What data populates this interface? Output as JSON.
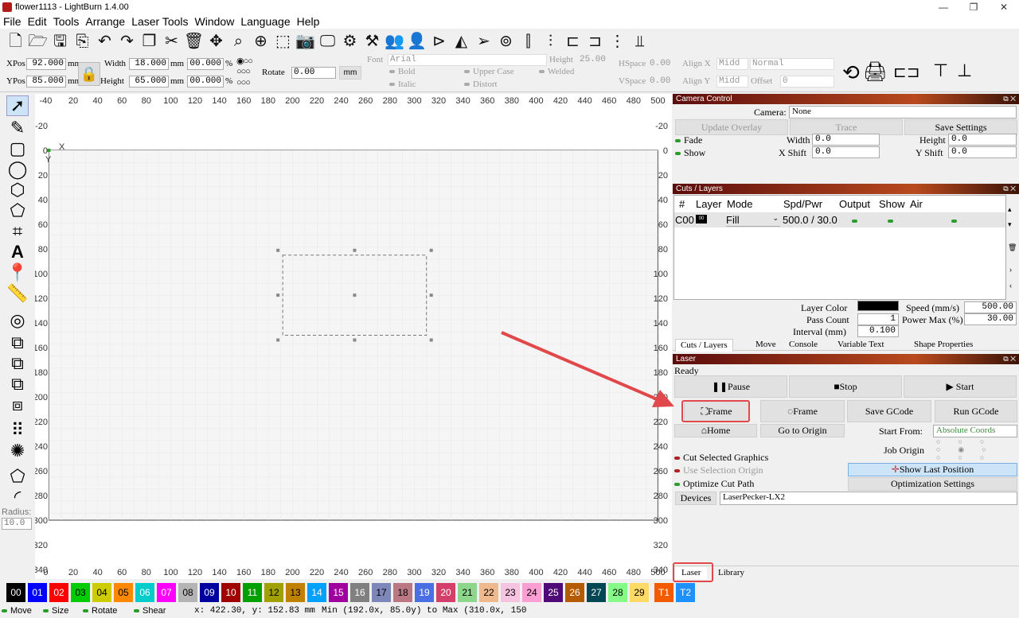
{
  "window": {
    "title": "flower1113 - LightBurn 1.4.00",
    "controls": [
      "—",
      "❐",
      "✕"
    ]
  },
  "menu": [
    "File",
    "Edit",
    "Tools",
    "Arrange",
    "Laser Tools",
    "Window",
    "Language",
    "Help"
  ],
  "toolbar_icons": [
    "new-file-icon",
    "open-folder-icon",
    "save-icon",
    "import-icon",
    "undo-icon",
    "redo-icon",
    "copy-icon",
    "cut-icon",
    "delete-icon",
    "move-icon",
    "zoom-fit-icon",
    "zoom-in-icon",
    "zoom-selection-icon",
    "camera-icon",
    "monitor-icon",
    "settings-icon",
    "tools-icon",
    "users-icon",
    "user-icon",
    "convert-icon",
    "mirror-icon",
    "send-icon",
    "target-icon",
    "align-icon",
    "distribute-icon"
  ],
  "props": {
    "xpos_label": "XPos",
    "xpos": "92.000",
    "ypos_label": "YPos",
    "ypos": "85.000",
    "mm": "mm",
    "width_label": "Width",
    "width": "18.000",
    "height_label": "Height",
    "height": "65.000",
    "pct1": "00.000",
    "pct2": "00.000",
    "pct_sign": "%",
    "rotate_label": "Rotate",
    "rotate": "0.00",
    "rotate_unit": "mm",
    "font_label": "Font",
    "font": "Arial",
    "fheight_label": "Height",
    "fheight": "25.00",
    "bold": "Bold",
    "italic": "Italic",
    "upper": "Upper Case",
    "distort": "Distort",
    "welded": "Welded",
    "hspace_label": "HSpace",
    "hspace": "0.00",
    "vspace_label": "VSpace",
    "vspace": "0.00",
    "alignx_label": "Align X",
    "alignx": "Midd",
    "aligny_label": "Align Y",
    "aligny": "Midd",
    "normal": "Normal",
    "offset_label": "Offset",
    "offset": "0"
  },
  "left_tools": {
    "radius_label": "Radius:",
    "radius": "10.0"
  },
  "rulers": {
    "top": [
      "-40",
      "20",
      "40",
      "60",
      "80",
      "100",
      "120",
      "140",
      "160",
      "180",
      "200",
      "220",
      "240",
      "260",
      "280",
      "300",
      "320",
      "340",
      "360",
      "380",
      "400",
      "420",
      "440",
      "460",
      "480",
      "500"
    ],
    "left": [
      "-20",
      "0",
      "20",
      "40",
      "60",
      "80",
      "100",
      "120",
      "140",
      "160",
      "180",
      "200",
      "220",
      "240",
      "260",
      "280",
      "300",
      "320",
      "340"
    ],
    "origin_x": "X",
    "origin_y": "Y"
  },
  "camera": {
    "header": "Camera Control",
    "camera_label": "Camera:",
    "camera": "None",
    "update_overlay": "Update Overlay",
    "trace": "Trace",
    "save_settings": "Save Settings",
    "fade": "Fade",
    "show": "Show",
    "width_label": "Width",
    "width": "0.0",
    "height_label": "Height",
    "height": "0.0",
    "xshift_label": "X Shift",
    "xshift": "0.0",
    "yshift_label": "Y Shift",
    "yshift": "0.0"
  },
  "layers": {
    "header": "Cuts / Layers",
    "cols": [
      "#",
      "Layer",
      "Mode",
      "Spd/Pwr",
      "Output",
      "Show",
      "Air"
    ],
    "row": {
      "id": "C00",
      "layer": "00",
      "mode": "Fill",
      "spdpwr": "500.0 / 30.0"
    },
    "layer_color_label": "Layer Color",
    "pass_count_label": "Pass Count",
    "pass_count": "1",
    "interval_label": "Interval (mm)",
    "interval": "0.100",
    "speed_label": "Speed (mm/s)",
    "speed": "500.00",
    "power_label": "Power Max (%)",
    "power": "30.00",
    "layer_color": "#000000"
  },
  "tabs": [
    "Cuts / Layers",
    "Move",
    "Console",
    "Variable Text",
    "Shape Properties"
  ],
  "laser": {
    "header": "Laser",
    "status": "Ready",
    "pause": "Pause",
    "stop": "Stop",
    "start": "Start",
    "frame1": "Frame",
    "frame2": "Frame",
    "save_gcode": "Save GCode",
    "run_gcode": "Run GCode",
    "home": "Home",
    "go_origin": "Go to Origin",
    "start_from_label": "Start From:",
    "start_from": "Absolute Coords",
    "job_origin_label": "Job Origin",
    "cut_selected": "Cut Selected Graphics",
    "use_selection": "Use Selection Origin",
    "optimize": "Optimize Cut Path",
    "show_last": "Show Last Position",
    "opt_settings": "Optimization Settings",
    "devices": "Devices",
    "device": "LaserPecker-LX2"
  },
  "bottom_tabs": [
    "Laser",
    "Library"
  ],
  "palette": [
    {
      "l": "00",
      "c": "#000000",
      "t": "#ffffff"
    },
    {
      "l": "01",
      "c": "#0000ff",
      "t": "#ffffff"
    },
    {
      "l": "02",
      "c": "#ff0000",
      "t": "#ffffff"
    },
    {
      "l": "03",
      "c": "#00cc00",
      "t": "#000000"
    },
    {
      "l": "04",
      "c": "#cccc00",
      "t": "#000000"
    },
    {
      "l": "05",
      "c": "#ff8800",
      "t": "#000000"
    },
    {
      "l": "06",
      "c": "#00cccc",
      "t": "#ffffff"
    },
    {
      "l": "07",
      "c": "#ff00ff",
      "t": "#ffffff"
    },
    {
      "l": "08",
      "c": "#b4b4b4",
      "t": "#000000"
    },
    {
      "l": "09",
      "c": "#0000a0",
      "t": "#ffffff"
    },
    {
      "l": "10",
      "c": "#a00000",
      "t": "#ffffff"
    },
    {
      "l": "11",
      "c": "#00a000",
      "t": "#ffffff"
    },
    {
      "l": "12",
      "c": "#a0a000",
      "t": "#000000"
    },
    {
      "l": "13",
      "c": "#c08000",
      "t": "#000000"
    },
    {
      "l": "14",
      "c": "#00a0ff",
      "t": "#ffffff"
    },
    {
      "l": "15",
      "c": "#a000a0",
      "t": "#ffffff"
    },
    {
      "l": "16",
      "c": "#808080",
      "t": "#ffffff"
    },
    {
      "l": "17",
      "c": "#7d87b9",
      "t": "#000000"
    },
    {
      "l": "18",
      "c": "#bb7784",
      "t": "#000000"
    },
    {
      "l": "19",
      "c": "#4a6fe3",
      "t": "#ffffff"
    },
    {
      "l": "20",
      "c": "#d33f6a",
      "t": "#ffffff"
    },
    {
      "l": "21",
      "c": "#8cd78c",
      "t": "#000000"
    },
    {
      "l": "22",
      "c": "#f0b98d",
      "t": "#000000"
    },
    {
      "l": "23",
      "c": "#f6c4e1",
      "t": "#000000"
    },
    {
      "l": "24",
      "c": "#fa9ed4",
      "t": "#000000"
    },
    {
      "l": "25",
      "c": "#500a78",
      "t": "#ffffff"
    },
    {
      "l": "26",
      "c": "#b45a00",
      "t": "#ffffff"
    },
    {
      "l": "27",
      "c": "#004754",
      "t": "#ffffff"
    },
    {
      "l": "28",
      "c": "#86fa88",
      "t": "#000000"
    },
    {
      "l": "29",
      "c": "#ffdb66",
      "t": "#000000"
    },
    {
      "l": "T1",
      "c": "#f35b00",
      "t": "#ffffff"
    },
    {
      "l": "T2",
      "c": "#1e90ff",
      "t": "#ffffff"
    }
  ],
  "status": {
    "move": "Move",
    "size": "Size",
    "rotate": "Rotate",
    "shear": "Shear",
    "coords": "x: 422.30, y: 152.83 mm",
    "range": "Min (192.0x, 85.0y) to Max (310.0x, 150"
  }
}
